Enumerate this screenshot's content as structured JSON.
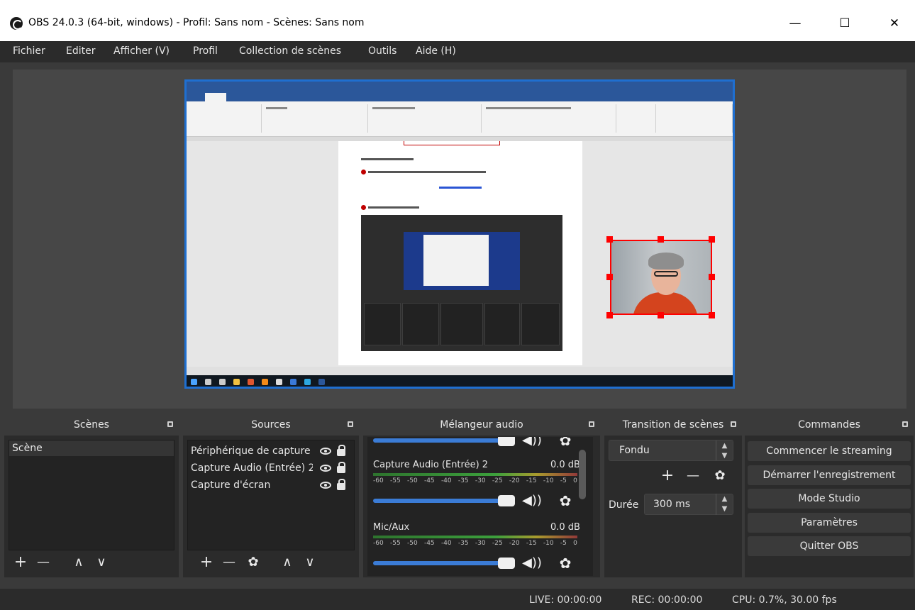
{
  "window": {
    "title": "OBS 24.0.3 (64-bit, windows) - Profil: Sans nom - Scènes: Sans nom",
    "minimize_glyph": "—",
    "maximize_glyph": "☐",
    "close_glyph": "✕"
  },
  "menu": [
    "Fichier",
    "Editer",
    "Afficher (V)",
    "Profil",
    "Collection de scènes",
    "Outils",
    "Aide (H)"
  ],
  "docks": {
    "scenes": {
      "title": "Scènes",
      "items": [
        "Scène"
      ]
    },
    "sources": {
      "title": "Sources",
      "items": [
        "Périphérique de capture",
        "Capture Audio (Entrée) 2",
        "Capture d'écran"
      ]
    },
    "mixer": {
      "title": "Mélangeur audio",
      "channels": [
        {
          "name": "Capture Audio (Entrée) 2",
          "db": "0.0 dB"
        },
        {
          "name": "Mic/Aux",
          "db": "0.0 dB"
        }
      ],
      "ticks": [
        "-60",
        "-55",
        "-50",
        "-45",
        "-40",
        "-35",
        "-30",
        "-25",
        "-20",
        "-15",
        "-10",
        "-5",
        "0"
      ]
    },
    "transitions": {
      "title": "Transition de scènes",
      "selected": "Fondu",
      "duration_label": "Durée",
      "duration_value": "300 ms"
    },
    "controls": {
      "title": "Commandes",
      "buttons": [
        "Commencer le streaming",
        "Démarrer l'enregistrement",
        "Mode Studio",
        "Paramètres",
        "Quitter OBS"
      ]
    }
  },
  "status": {
    "live": "LIVE: 00:00:00",
    "rec": "REC: 00:00:00",
    "cpu": "CPU: 0.7%, 30.00 fps"
  },
  "glyphs": {
    "plus": "+",
    "minus": "—",
    "up": "∧",
    "down": "∨",
    "gear": "✿",
    "speaker": "◀))"
  },
  "colors": {
    "accent_blue": "#3b7cd6",
    "selection_red": "#ff0000"
  }
}
